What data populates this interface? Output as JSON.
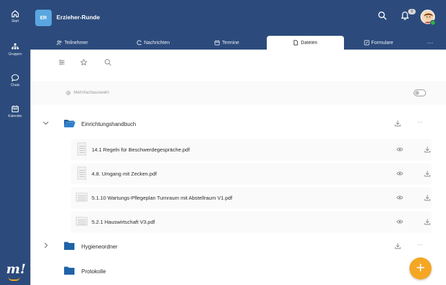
{
  "sidebar": {
    "items": [
      {
        "label": "Start",
        "icon": "home-icon"
      },
      {
        "label": "Gruppen",
        "icon": "groups-icon"
      },
      {
        "label": "Chats",
        "icon": "chat-icon"
      },
      {
        "label": "Kalender",
        "icon": "calendar-icon"
      }
    ],
    "logo": "m!"
  },
  "header": {
    "group_initials": "ER",
    "group_title": "Erzieher-Runde",
    "notification_count": "9"
  },
  "tabs": [
    {
      "label": "Teilnehmer",
      "icon": "people-icon"
    },
    {
      "label": "Nachrichten",
      "icon": "messages-icon"
    },
    {
      "label": "Termine",
      "icon": "calendar-icon"
    },
    {
      "label": "Dateien",
      "icon": "file-icon",
      "active": true
    },
    {
      "label": "Formulare",
      "icon": "form-icon"
    },
    {
      "label": "···",
      "icon": "more-icon"
    }
  ],
  "toolbar": {
    "multi_select_label": "Mehrfachauswahl"
  },
  "folders": [
    {
      "name": "Einrichtungshandbuch",
      "expanded": true,
      "files": [
        {
          "name": "14.1 Regeln für Beschwerdegespräche.pdf"
        },
        {
          "name": "4.8. Umgang mit Zecken.pdf"
        },
        {
          "name": "5.1.10 Wartungs-Pflegeplan Turnraum mit Abstellraum V1.pdf"
        },
        {
          "name": "5.2.1 Hauswirtschaft V3.pdf"
        }
      ]
    },
    {
      "name": "Hygieneordner",
      "expanded": false
    },
    {
      "name": "Protokolle",
      "expanded": false
    }
  ],
  "actions": {
    "more": "···"
  },
  "fab": "+",
  "colors": {
    "primary": "#2c4b7c",
    "accent": "#f5a623",
    "folder": "#1f63a8",
    "avatar": "#5aa6e0"
  }
}
